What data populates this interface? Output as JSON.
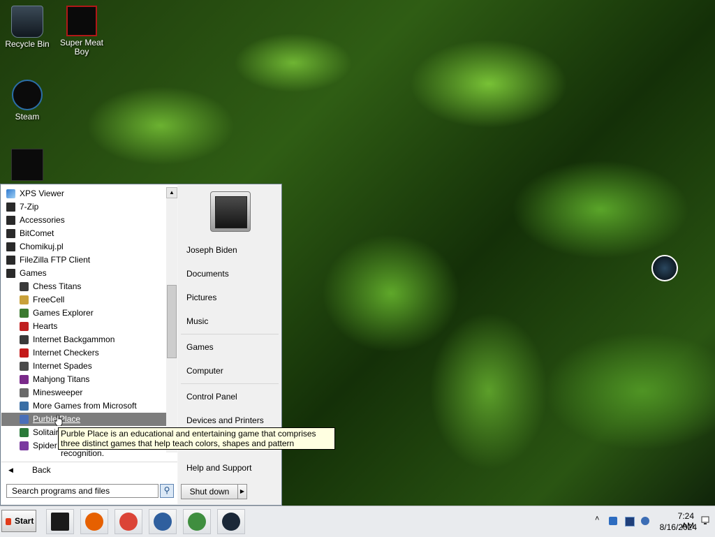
{
  "desktop_icons": [
    {
      "label": "Recycle Bin",
      "icon": "recycle-bin-icon"
    },
    {
      "label": "Super Meat Boy",
      "icon": "super-meat-boy-icon"
    },
    {
      "label": "Steam",
      "icon": "steam-icon"
    },
    {
      "label": "",
      "icon": "app-shortcut-icon"
    }
  ],
  "start_menu": {
    "programs": [
      {
        "label": "XPS Viewer",
        "icon": "xps-viewer-icon",
        "level": "top"
      },
      {
        "label": "7-Zip",
        "icon": "folder-icon",
        "level": "top"
      },
      {
        "label": "Accessories",
        "icon": "folder-icon",
        "level": "top"
      },
      {
        "label": "BitComet",
        "icon": "folder-icon",
        "level": "top"
      },
      {
        "label": "Chomikuj.pl",
        "icon": "folder-icon",
        "level": "top"
      },
      {
        "label": "FileZilla FTP Client",
        "icon": "folder-icon",
        "level": "top"
      },
      {
        "label": "Games",
        "icon": "folder-icon",
        "level": "top"
      },
      {
        "label": "Chess Titans",
        "icon": "chess-icon",
        "level": "sub"
      },
      {
        "label": "FreeCell",
        "icon": "freecell-icon",
        "level": "sub"
      },
      {
        "label": "Games Explorer",
        "icon": "games-explorer-icon",
        "level": "sub"
      },
      {
        "label": "Hearts",
        "icon": "hearts-icon",
        "level": "sub"
      },
      {
        "label": "Internet Backgammon",
        "icon": "backgammon-icon",
        "level": "sub"
      },
      {
        "label": "Internet Checkers",
        "icon": "checkers-icon",
        "level": "sub"
      },
      {
        "label": "Internet Spades",
        "icon": "spades-icon",
        "level": "sub"
      },
      {
        "label": "Mahjong Titans",
        "icon": "mahjong-icon",
        "level": "sub"
      },
      {
        "label": "Minesweeper",
        "icon": "minesweeper-icon",
        "level": "sub"
      },
      {
        "label": "More Games from Microsoft",
        "icon": "more-games-icon",
        "level": "sub"
      },
      {
        "label": "Purble Place",
        "icon": "purble-place-icon",
        "level": "sub",
        "selected": true
      },
      {
        "label": "Solitaire",
        "icon": "solitaire-icon",
        "level": "sub"
      },
      {
        "label": "Spider Solitaire",
        "icon": "spider-solitaire-icon",
        "level": "sub"
      }
    ],
    "back_label": "Back",
    "search_placeholder": "Search programs and files",
    "right_items": [
      {
        "label": "Joseph Biden",
        "name": "user-name-link"
      },
      {
        "label": "Documents",
        "name": "documents-link"
      },
      {
        "label": "Pictures",
        "name": "pictures-link"
      },
      {
        "label": "Music",
        "name": "music-link"
      },
      {
        "label": "Games",
        "name": "games-link"
      },
      {
        "label": "Computer",
        "name": "computer-link"
      },
      {
        "label": "Control Panel",
        "name": "control-panel-link"
      },
      {
        "label": "Devices and Printers",
        "name": "devices-printers-link"
      },
      {
        "label": "Help and Support",
        "name": "help-support-link"
      }
    ],
    "shutdown_label": "Shut down"
  },
  "tooltip_text": "Purble Place is an educational and entertaining game that comprises three distinct games that help teach colors, shapes and pattern recognition.",
  "taskbar": {
    "start_label": "Start",
    "apps": [
      {
        "name": "taskbar-app-generic",
        "icon": "black-box-icon",
        "color": "#1a1a1a"
      },
      {
        "name": "taskbar-app-firefox",
        "icon": "firefox-icon",
        "color": "#e66000"
      },
      {
        "name": "taskbar-app-chrome",
        "icon": "chrome-icon",
        "color": "#db4437"
      },
      {
        "name": "taskbar-app-virtualbox",
        "icon": "virtualbox-icon",
        "color": "#2f5f9e"
      },
      {
        "name": "taskbar-app-network",
        "icon": "network-users-icon",
        "color": "#3f8e3f"
      },
      {
        "name": "taskbar-app-steam",
        "icon": "steam-icon",
        "color": "#1b2838"
      }
    ],
    "tray_icons": [
      "show-hidden-icons-icon",
      "bluetooth-icon",
      "network-icon",
      "volume-icon"
    ],
    "time": "7:24 AM",
    "date": "8/16/2024"
  },
  "colors": {
    "selection": "#7d7d7d",
    "tooltip_bg": "#ffffe1",
    "taskbar_bg": "#e9ebee"
  }
}
